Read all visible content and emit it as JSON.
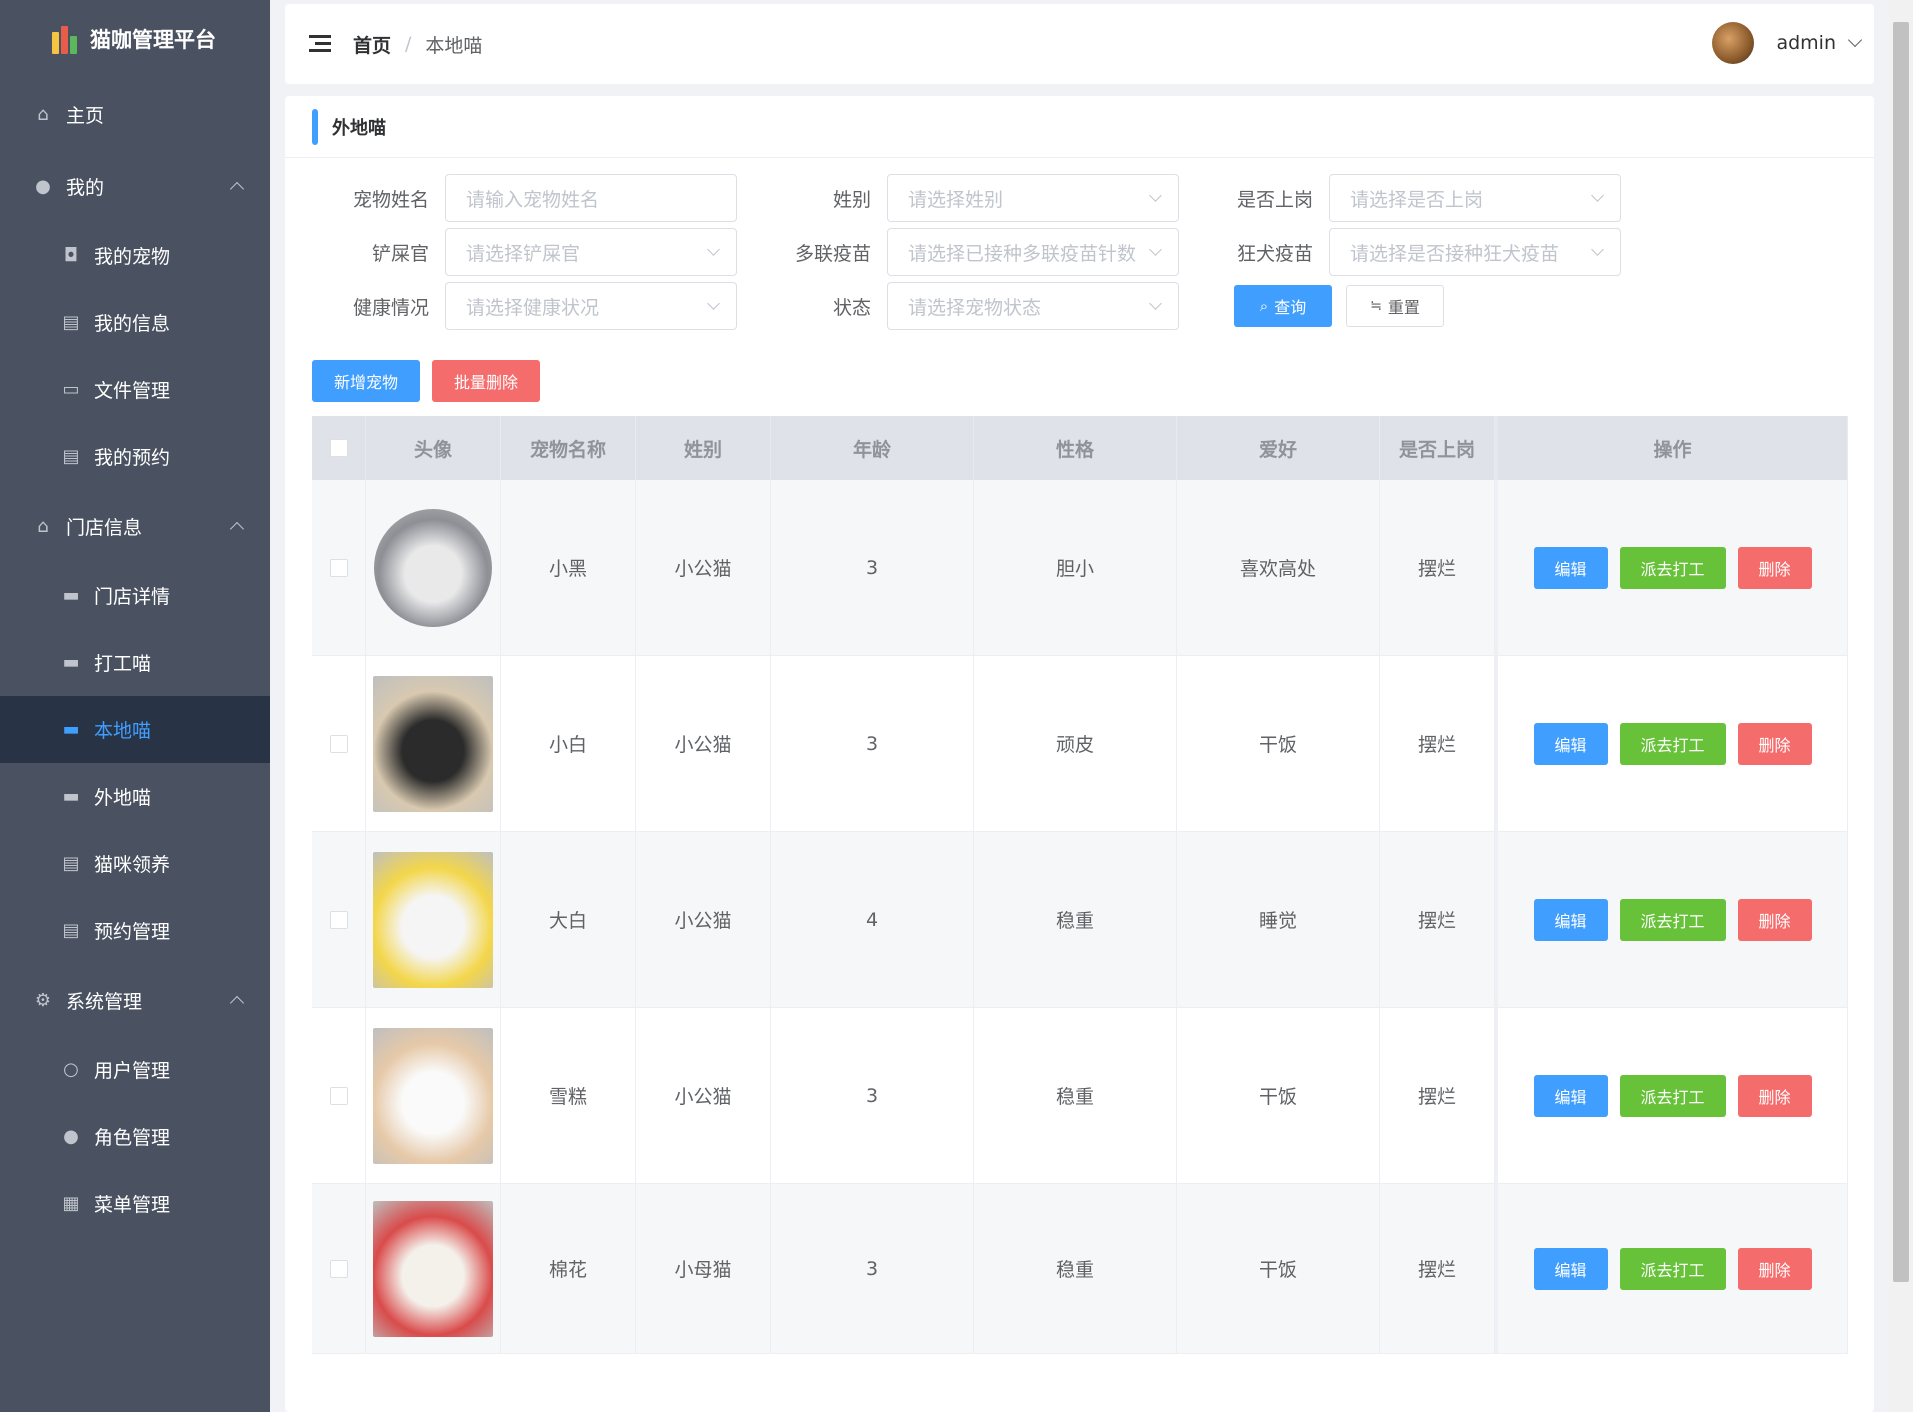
{
  "app": {
    "title": "猫咖管理平台"
  },
  "sidebar": {
    "items": [
      {
        "label": "主页",
        "level": "top",
        "icon": "home-icon"
      },
      {
        "label": "我的",
        "level": "top",
        "icon": "user-icon",
        "expanded": true
      },
      {
        "label": "我的宠物",
        "level": "sub",
        "icon": "pet-icon"
      },
      {
        "label": "我的信息",
        "level": "sub",
        "icon": "document-icon"
      },
      {
        "label": "文件管理",
        "level": "sub",
        "icon": "folder-icon"
      },
      {
        "label": "我的预约",
        "level": "sub",
        "icon": "document-icon"
      },
      {
        "label": "门店信息",
        "level": "top",
        "icon": "store-icon",
        "expanded": true
      },
      {
        "label": "门店详情",
        "level": "sub",
        "icon": "monitor-icon"
      },
      {
        "label": "打工喵",
        "level": "sub",
        "icon": "monitor-icon"
      },
      {
        "label": "本地喵",
        "level": "sub",
        "icon": "monitor-icon",
        "active": true
      },
      {
        "label": "外地喵",
        "level": "sub",
        "icon": "monitor-icon"
      },
      {
        "label": "猫咪领养",
        "level": "sub",
        "icon": "document-icon"
      },
      {
        "label": "预约管理",
        "level": "sub",
        "icon": "document-icon"
      },
      {
        "label": "系统管理",
        "level": "top",
        "icon": "gear-icon",
        "expanded": true
      },
      {
        "label": "用户管理",
        "level": "sub",
        "icon": "user-icon"
      },
      {
        "label": "角色管理",
        "level": "sub",
        "icon": "role-icon"
      },
      {
        "label": "菜单管理",
        "level": "sub",
        "icon": "grid-icon"
      }
    ]
  },
  "header": {
    "breadcrumb": {
      "home": "首页",
      "separator": "/",
      "current": "本地喵"
    },
    "user": {
      "name": "admin"
    }
  },
  "panel": {
    "title": "外地喵"
  },
  "filters": {
    "pet_name": {
      "label": "宠物姓名",
      "placeholder": "请输入宠物姓名"
    },
    "gender": {
      "label": "姓别",
      "placeholder": "请选择姓别"
    },
    "on_duty": {
      "label": "是否上岗",
      "placeholder": "请选择是否上岗"
    },
    "owner": {
      "label": "铲屎官",
      "placeholder": "请选择铲屎官"
    },
    "multi_vaccine": {
      "label": "多联疫苗",
      "placeholder": "请选择已接种多联疫苗针数"
    },
    "rabies_vaccine": {
      "label": "狂犬疫苗",
      "placeholder": "请选择是否接种狂犬疫苗"
    },
    "health": {
      "label": "健康情况",
      "placeholder": "请选择健康状况"
    },
    "status": {
      "label": "状态",
      "placeholder": "请选择宠物状态"
    },
    "search_label": "查询",
    "reset_label": "重置"
  },
  "toolbar": {
    "add_label": "新增宠物",
    "batch_delete_label": "批量删除"
  },
  "table": {
    "headers": [
      "头像",
      "宠物名称",
      "姓别",
      "年龄",
      "性格",
      "爱好",
      "是否上岗",
      "操作"
    ],
    "actions": {
      "edit": "编辑",
      "dispatch": "派去打工",
      "delete": "删除"
    },
    "rows": [
      {
        "name": "小黑",
        "gender": "小公猫",
        "age": "3",
        "personality": "胆小",
        "hobby": "喜欢高处",
        "on_duty": "摆烂"
      },
      {
        "name": "小白",
        "gender": "小公猫",
        "age": "3",
        "personality": "顽皮",
        "hobby": "干饭",
        "on_duty": "摆烂"
      },
      {
        "name": "大白",
        "gender": "小公猫",
        "age": "4",
        "personality": "稳重",
        "hobby": "睡觉",
        "on_duty": "摆烂"
      },
      {
        "name": "雪糕",
        "gender": "小公猫",
        "age": "3",
        "personality": "稳重",
        "hobby": "干饭",
        "on_duty": "摆烂"
      },
      {
        "name": "棉花",
        "gender": "小母猫",
        "age": "3",
        "personality": "稳重",
        "hobby": "干饭",
        "on_duty": "摆烂"
      }
    ]
  },
  "colors": {
    "primary": "#409eff",
    "success": "#67c23a",
    "danger": "#f56c6c",
    "sidebar_bg": "#4a5261",
    "sidebar_active_bg": "#283446"
  }
}
